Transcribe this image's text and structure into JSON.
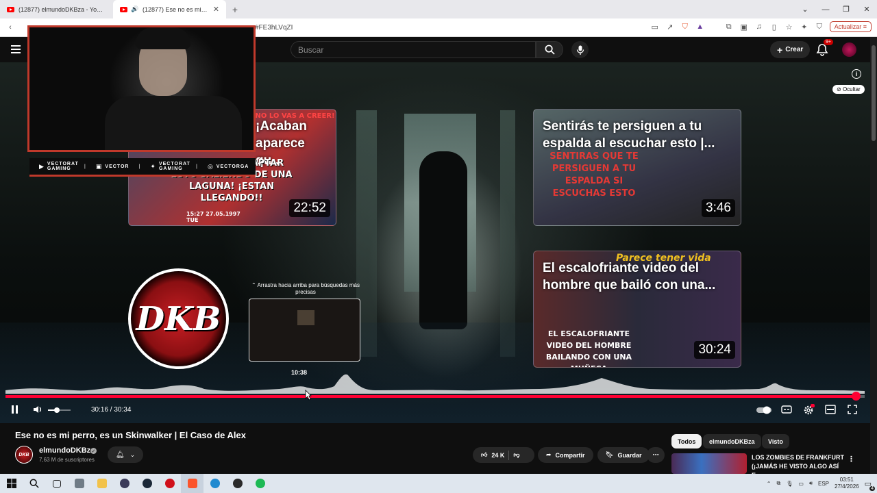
{
  "browser": {
    "tabs": [
      {
        "title": "(12877) elmundoDKBza - YouTube",
        "active": false
      },
      {
        "title": "(12877) Ese no es mi perro, es un Skinwalker",
        "active": true
      }
    ],
    "new_tab_label": "+",
    "url": "#FE3hLVqZI",
    "update_button": "Actualizar",
    "window_controls": [
      "⌄",
      "—",
      "❐",
      "✕"
    ]
  },
  "youtube_header": {
    "search_placeholder": "Buscar",
    "create_label": "Crear",
    "notification_badge": "9+"
  },
  "player": {
    "info_label": "i",
    "hide_label": "Ocultar",
    "current_time": "30:16",
    "duration": "30:34",
    "time_display": "30:16 / 30:34",
    "progress_fraction": 0.99,
    "hover_time": "10:38",
    "hover_fraction": 0.35,
    "volume_fraction": 0.4,
    "drag_hint": "⌃ Arrastra hacia arriba para búsquedas más precisas",
    "channel_logo_text": "DKB"
  },
  "webcam": {
    "socials": [
      {
        "icon": "youtube-icon",
        "label": "VECTORAT GAMING"
      },
      {
        "icon": "twitch-icon",
        "label": "VECTOR"
      },
      {
        "icon": "twitter-icon",
        "label": "VECTORAT GAMING"
      },
      {
        "icon": "instagram-icon",
        "label": "VECTORGA"
      }
    ]
  },
  "end_cards": [
    {
      "title": "¡Acaban aparece qu...",
      "duration": "22:52",
      "caption": "¡ACABAN DE CAPTAR ESTO SALIENDO DE UNA LAGUNA! ¡ESTAN LLEGANDO!!",
      "stamp": "15:27 27.05.1997 TUE",
      "badge": "¡NO LO VAS A CREER!"
    },
    {
      "title": "Sentirás te persiguen a tu espalda al escuchar esto |...",
      "duration": "3:46",
      "caption": "SENTIRAS QUE TE PERSIGUEN A TU ESPALDA SI ESCUCHAS ESTO"
    },
    {
      "title": "El escalofriante video del hombre que bailó con una...",
      "duration": "30:24",
      "caption": "EL ESCALOFRIANTE VIDEO DEL HOMBRE BAILANDO CON UNA MUÑECA",
      "badge": "Parece tener vida"
    }
  ],
  "video": {
    "title": "Ese no es mi perro, es un Skinwalker | El Caso de Alex",
    "channel_name": "elmundoDKBza",
    "channel_avatar_text": "DKB",
    "subscribers": "7,63 M de suscriptores",
    "likes": "24 K",
    "share_label": "Compartir",
    "save_label": "Guardar"
  },
  "sidebar": {
    "chips": [
      "Todos",
      "elmundoDKBza",
      "Visto"
    ],
    "recommendation": {
      "title": "LOS ZOMBIES DE FRANKFURT (¡JAMÁS HE VISTO ALGO ASÍ E..."
    }
  },
  "taskbar": {
    "language": "ESP",
    "time": "03:51",
    "date": "27/4/2026",
    "notification_count": "4"
  }
}
